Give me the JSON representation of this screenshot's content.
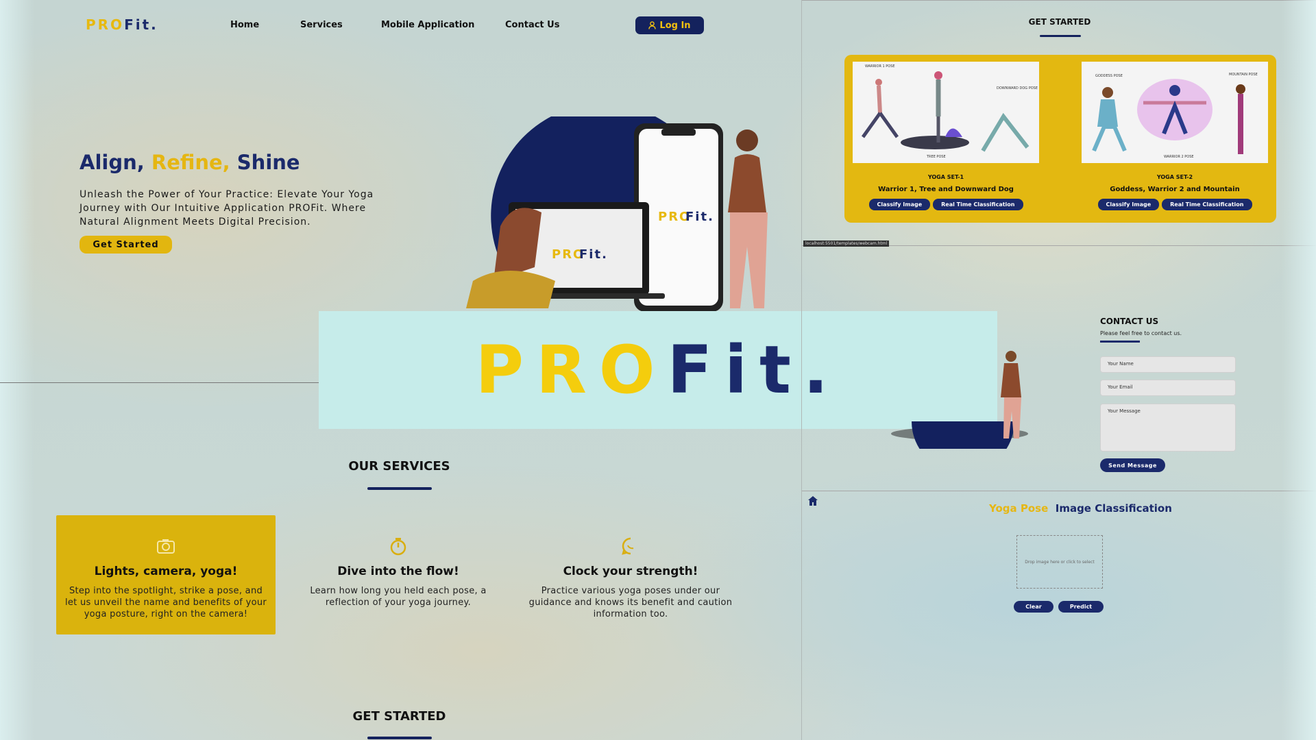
{
  "brand": {
    "pro": "PRO",
    "fit": "Fit."
  },
  "nav": {
    "items": [
      "Home",
      "Services",
      "Mobile Application",
      "Contact Us"
    ],
    "login": "Log In"
  },
  "hero": {
    "title_part1": "Align,",
    "title_part2": "Refine,",
    "title_part3": "Shine",
    "text": "Unleash the Power of Your Practice: Elevate Your Yoga Journey with Our Intuitive Application PROFit. Where Natural Alignment Meets Digital Precision.",
    "cta": "Get Started"
  },
  "services": {
    "title": "OUR SERVICES",
    "cards": [
      {
        "title": "Lights, camera, yoga!",
        "text": "Step into the spotlight, strike a pose, and let us unveil the name and benefits of your yoga posture, right on the camera!",
        "icon": "camera-icon"
      },
      {
        "title": "Dive into the flow!",
        "text": "Learn how long you held each pose, a reflection of your yoga journey.",
        "icon": "stopwatch-icon"
      },
      {
        "title": "Clock your strength!",
        "text": "Practice various yoga poses under our guidance and knows its benefit and caution information too.",
        "icon": "chat-icon"
      }
    ]
  },
  "get_started_bottom": "GET STARTED",
  "get_started_panel": {
    "title": "GET STARTED",
    "sets": [
      {
        "label": "YOGA SET-1",
        "name": "Warrior 1, Tree and Downward Dog",
        "btn1": "Classify Image",
        "btn2": "Real Time Classification",
        "poses": [
          "WARRIOR 1 POSE",
          "TREE POSE",
          "DOWNWARD DOG POSE"
        ]
      },
      {
        "label": "YOGA SET-2",
        "name": "Goddess, Warrior 2 and Mountain",
        "btn1": "Classify Image",
        "btn2": "Real Time Classification",
        "poses": [
          "GODDESS POSE",
          "WARRIOR 2 POSE",
          "MOUNTAIN POSE"
        ]
      }
    ],
    "url": "localhost:5501/templates/webcam.html"
  },
  "contact": {
    "title": "CONTACT US",
    "subtitle": "Please feel free to contact us.",
    "name_placeholder": "Your Name",
    "email_placeholder": "Your Email",
    "message_placeholder": "Your Message",
    "send": "Send Message"
  },
  "classify": {
    "title_part1": "Yoga Pose",
    "title_part2": "Image Classification",
    "drop": "Drop image here or click to select",
    "clear": "Clear",
    "predict": "Predict"
  },
  "colors": {
    "navy": "#1b2a6b",
    "yellow": "#e3b811",
    "banner": "#c6ecea"
  }
}
